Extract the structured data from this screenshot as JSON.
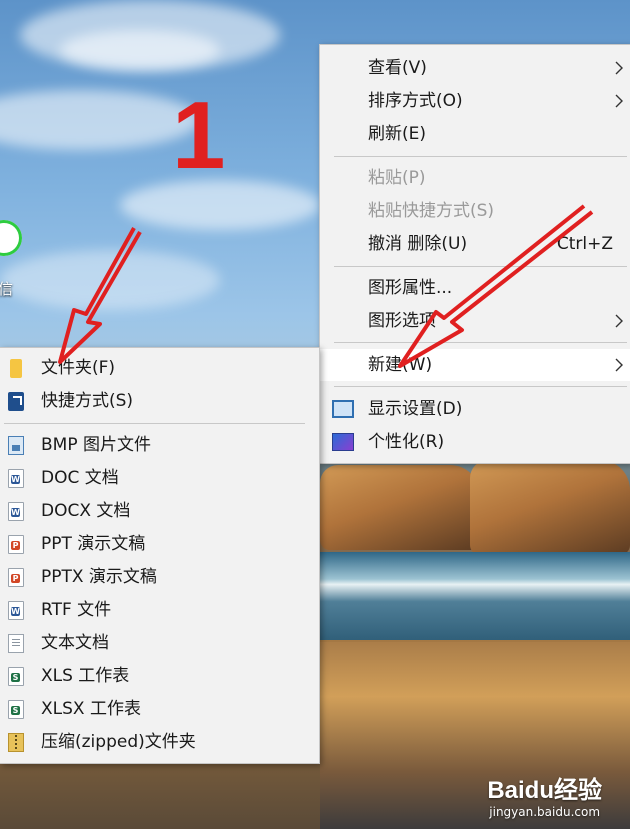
{
  "desktop": {
    "wechat_label": "信"
  },
  "annotation": {
    "step_number": "1"
  },
  "context_menu": {
    "items": [
      {
        "label": "查看(V)",
        "has_submenu": true
      },
      {
        "label": "排序方式(O)",
        "has_submenu": true
      },
      {
        "label": "刷新(E)"
      },
      {
        "label": "粘贴(P)",
        "disabled": true
      },
      {
        "label": "粘贴快捷方式(S)",
        "disabled": true
      },
      {
        "label": "撤消 删除(U)",
        "shortcut": "Ctrl+Z"
      },
      {
        "label": "图形属性..."
      },
      {
        "label": "图形选项",
        "has_submenu": true
      },
      {
        "label": "新建(W)",
        "has_submenu": true,
        "highlighted": true
      },
      {
        "label": "显示设置(D)",
        "icon": "display-icon"
      },
      {
        "label": "个性化(R)",
        "icon": "personalize-icon"
      }
    ]
  },
  "new_submenu": {
    "items": [
      {
        "label": "文件夹(F)",
        "icon": "folder-icon"
      },
      {
        "label": "快捷方式(S)",
        "icon": "shortcut-icon"
      },
      {
        "label": "BMP 图片文件",
        "icon": "bmp-file-icon"
      },
      {
        "label": "DOC 文档",
        "icon": "word-doc-icon",
        "icon_letter": "W",
        "icon_color": "#2b5797"
      },
      {
        "label": "DOCX 文档",
        "icon": "word-docx-icon",
        "icon_letter": "W",
        "icon_color": "#2b5797"
      },
      {
        "label": "PPT 演示文稿",
        "icon": "ppt-icon",
        "icon_letter": "P",
        "icon_color": "#d24726"
      },
      {
        "label": "PPTX 演示文稿",
        "icon": "pptx-icon",
        "icon_letter": "P",
        "icon_color": "#d24726"
      },
      {
        "label": "RTF 文件",
        "icon": "rtf-icon",
        "icon_letter": "W",
        "icon_color": "#2b5797"
      },
      {
        "label": "文本文档",
        "icon": "text-file-icon"
      },
      {
        "label": "XLS 工作表",
        "icon": "xls-icon",
        "icon_letter": "S",
        "icon_color": "#1e7145"
      },
      {
        "label": "XLSX 工作表",
        "icon": "xlsx-icon",
        "icon_letter": "S",
        "icon_color": "#1e7145"
      },
      {
        "label": "压缩(zipped)文件夹",
        "icon": "zip-folder-icon"
      }
    ]
  },
  "watermark": {
    "brand": "Baidu经验",
    "url": "jingyan.baidu.com"
  },
  "colors": {
    "annotation_red": "#e02020",
    "menu_background": "#f2f2f2",
    "menu_highlight": "#ffffff"
  }
}
